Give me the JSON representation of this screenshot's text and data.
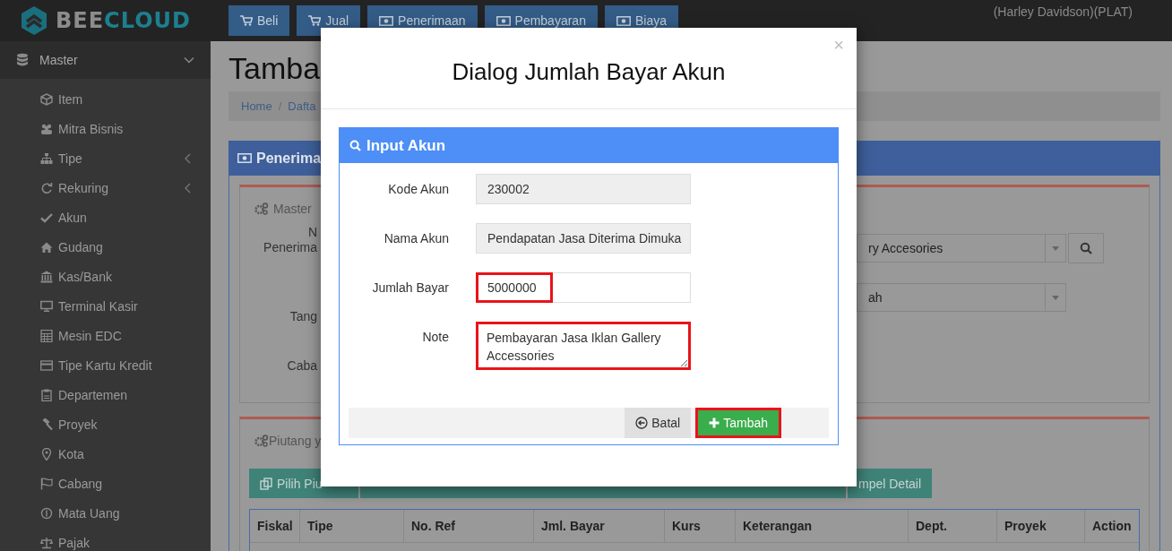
{
  "logo": {
    "text": "BEE",
    "accent": "CLOUD"
  },
  "top_nav": [
    {
      "label": "Beli",
      "kind": "cart"
    },
    {
      "label": "Jual",
      "kind": "cart"
    },
    {
      "label": "Penerimaan",
      "kind": "money"
    },
    {
      "label": "Pembayaran",
      "kind": "money"
    },
    {
      "label": "Biaya",
      "kind": "money"
    }
  ],
  "user": {
    "name": "(Harley Davidson)(PLAT)"
  },
  "sidebar": {
    "section": {
      "label": "Master",
      "expanded": true
    },
    "items": [
      {
        "label": "Item",
        "submenu": false
      },
      {
        "label": "Mitra Bisnis",
        "submenu": false
      },
      {
        "label": "Tipe",
        "submenu": true
      },
      {
        "label": "Rekuring",
        "submenu": true
      },
      {
        "label": "Akun",
        "submenu": false
      },
      {
        "label": "Gudang",
        "submenu": false
      },
      {
        "label": "Kas/Bank",
        "submenu": false
      },
      {
        "label": "Terminal Kasir",
        "submenu": false
      },
      {
        "label": "Mesin EDC",
        "submenu": false
      },
      {
        "label": "Tipe Kartu Kredit",
        "submenu": false
      },
      {
        "label": "Departemen",
        "submenu": false
      },
      {
        "label": "Proyek",
        "submenu": false
      },
      {
        "label": "Kota",
        "submenu": false
      },
      {
        "label": "Cabang",
        "submenu": false
      },
      {
        "label": "Mata Uang",
        "submenu": false
      },
      {
        "label": "Pajak",
        "submenu": false
      }
    ]
  },
  "page": {
    "title": "Tamba",
    "breadcrumb": {
      "items": [
        "Home",
        "Dafta"
      ],
      "separator": "/"
    },
    "panel": {
      "title": "Penerima",
      "master": {
        "title": "Master",
        "label_1": [
          "N",
          "Penerima"
        ],
        "label_2": "Tang",
        "label_3": "Caba",
        "fields": [
          {
            "value": "ry Accesories",
            "search_button": true
          },
          {
            "value": "ah",
            "search_button": false
          }
        ]
      },
      "piutang": {
        "title": "Piutang y",
        "buttons": [
          "Pilih Piu",
          "mpel Detail"
        ],
        "table": {
          "columns": [
            "Fiskal",
            "Tipe",
            "No. Ref",
            "Jml. Bayar",
            "Kurs",
            "Keterangan",
            "Dept.",
            "Proyek",
            "Action"
          ]
        }
      }
    }
  },
  "modal": {
    "title": "Dialog Jumlah Bayar Akun",
    "close": "×",
    "panel_title": "Input Akun",
    "fields": [
      {
        "label": "Kode Akun",
        "value": "230002",
        "kind": "readonly",
        "highlighted": false
      },
      {
        "label": "Nama Akun",
        "value": "Pendapatan Jasa Diterima Dimuka",
        "kind": "readonly",
        "highlighted": false
      },
      {
        "label": "Jumlah Bayar",
        "value": "5000000",
        "kind": "input",
        "highlighted": true
      },
      {
        "label": "Note",
        "value": "Pembayaran Jasa Iklan Gallery Accessories",
        "kind": "textarea",
        "highlighted": true
      }
    ],
    "buttons": [
      {
        "label": "Batal",
        "kind": "cancel",
        "highlighted": false
      },
      {
        "label": "Tambah",
        "kind": "add",
        "highlighted": true
      }
    ]
  }
}
